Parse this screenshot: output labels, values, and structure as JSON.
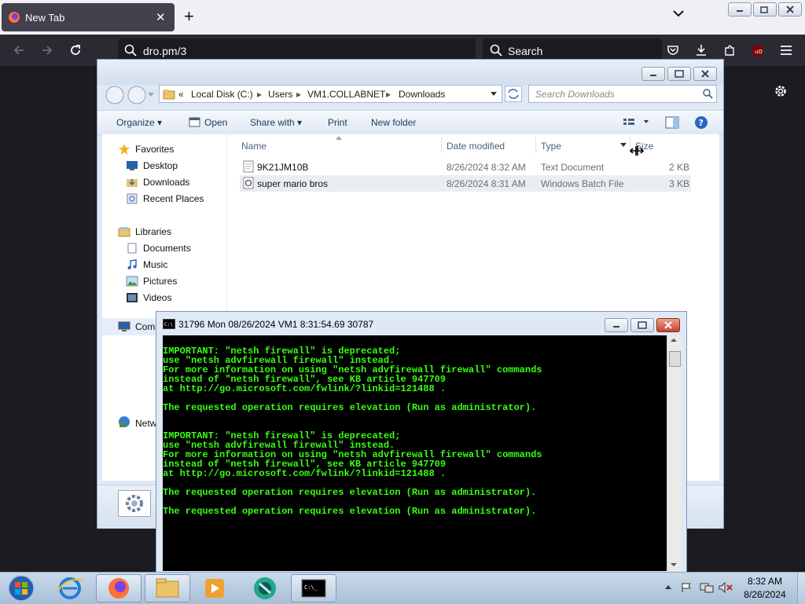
{
  "browser": {
    "tab_title": "New Tab",
    "url": "dro.pm/3",
    "search_placeholder": "Search"
  },
  "explorer": {
    "breadcrumb": [
      "Local Disk (C:)",
      "Users",
      "VM1.COLLABNET",
      "Downloads"
    ],
    "breadcrumb_prefix": "«",
    "search_placeholder": "Search Downloads",
    "toolbar": {
      "organize": "Organize",
      "open": "Open",
      "share_with": "Share with",
      "print": "Print",
      "new_folder": "New folder"
    },
    "nav": {
      "favorites": "Favorites",
      "desktop": "Desktop",
      "downloads": "Downloads",
      "recent_places": "Recent Places",
      "libraries": "Libraries",
      "documents": "Documents",
      "music": "Music",
      "pictures": "Pictures",
      "videos": "Videos",
      "computer": "Com",
      "network": "Netw"
    },
    "columns": {
      "name": "Name",
      "date": "Date modified",
      "type": "Type",
      "size": "Size"
    },
    "files": [
      {
        "name": "9K21JM10B",
        "date": "8/26/2024 8:32 AM",
        "type": "Text Document",
        "size": "2 KB"
      },
      {
        "name": "super mario bros",
        "date": "8/26/2024 8:31 AM",
        "type": "Windows Batch File",
        "size": "3 KB"
      }
    ]
  },
  "console": {
    "title": "31796 Mon 08/26/2024 VM1  8:31:54.69 30787",
    "lines": [
      "IMPORTANT: \"netsh firewall\" is deprecated;",
      "use \"netsh advfirewall firewall\" instead.",
      "For more information on using \"netsh advfirewall firewall\" commands",
      "instead of \"netsh firewall\", see KB article 947709",
      "at http://go.microsoft.com/fwlink/?linkid=121488 .",
      "",
      "The requested operation requires elevation (Run as administrator).",
      "",
      "",
      "IMPORTANT: \"netsh firewall\" is deprecated;",
      "use \"netsh advfirewall firewall\" instead.",
      "For more information on using \"netsh advfirewall firewall\" commands",
      "instead of \"netsh firewall\", see KB article 947709",
      "at http://go.microsoft.com/fwlink/?linkid=121488 .",
      "",
      "The requested operation requires elevation (Run as administrator).",
      "",
      "The requested operation requires elevation (Run as administrator)."
    ],
    "text_color": "#39ff14"
  },
  "taskbar": {
    "time": "8:32 AM",
    "date": "8/26/2024"
  }
}
